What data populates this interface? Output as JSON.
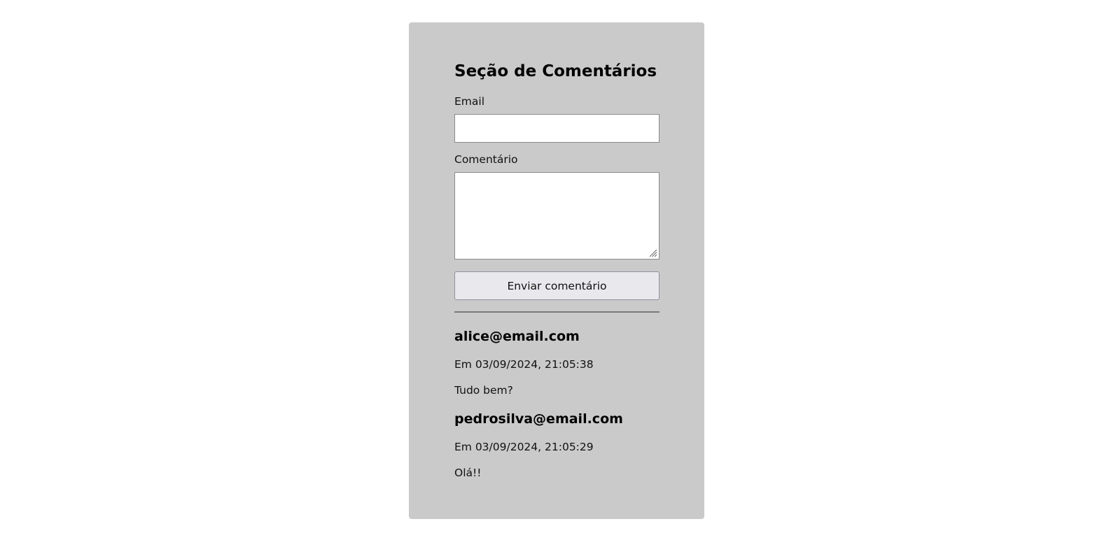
{
  "section": {
    "title": "Seção de Comentários"
  },
  "form": {
    "email_label": "Email",
    "email_value": "",
    "comment_label": "Comentário",
    "comment_value": "",
    "submit_label": "Enviar comentário"
  },
  "comments": [
    {
      "author": "alice@email.com",
      "date": "Em 03/09/2024, 21:05:38",
      "text": "Tudo bem?"
    },
    {
      "author": "pedrosilva@email.com",
      "date": "Em 03/09/2024, 21:05:29",
      "text": "Olá!!"
    }
  ],
  "icons": {
    "resize_grip": "resize-grip-icon"
  },
  "colors": {
    "card_background": "#cacaca",
    "page_background": "#ffffff",
    "button_background": "#e9e9ed"
  }
}
